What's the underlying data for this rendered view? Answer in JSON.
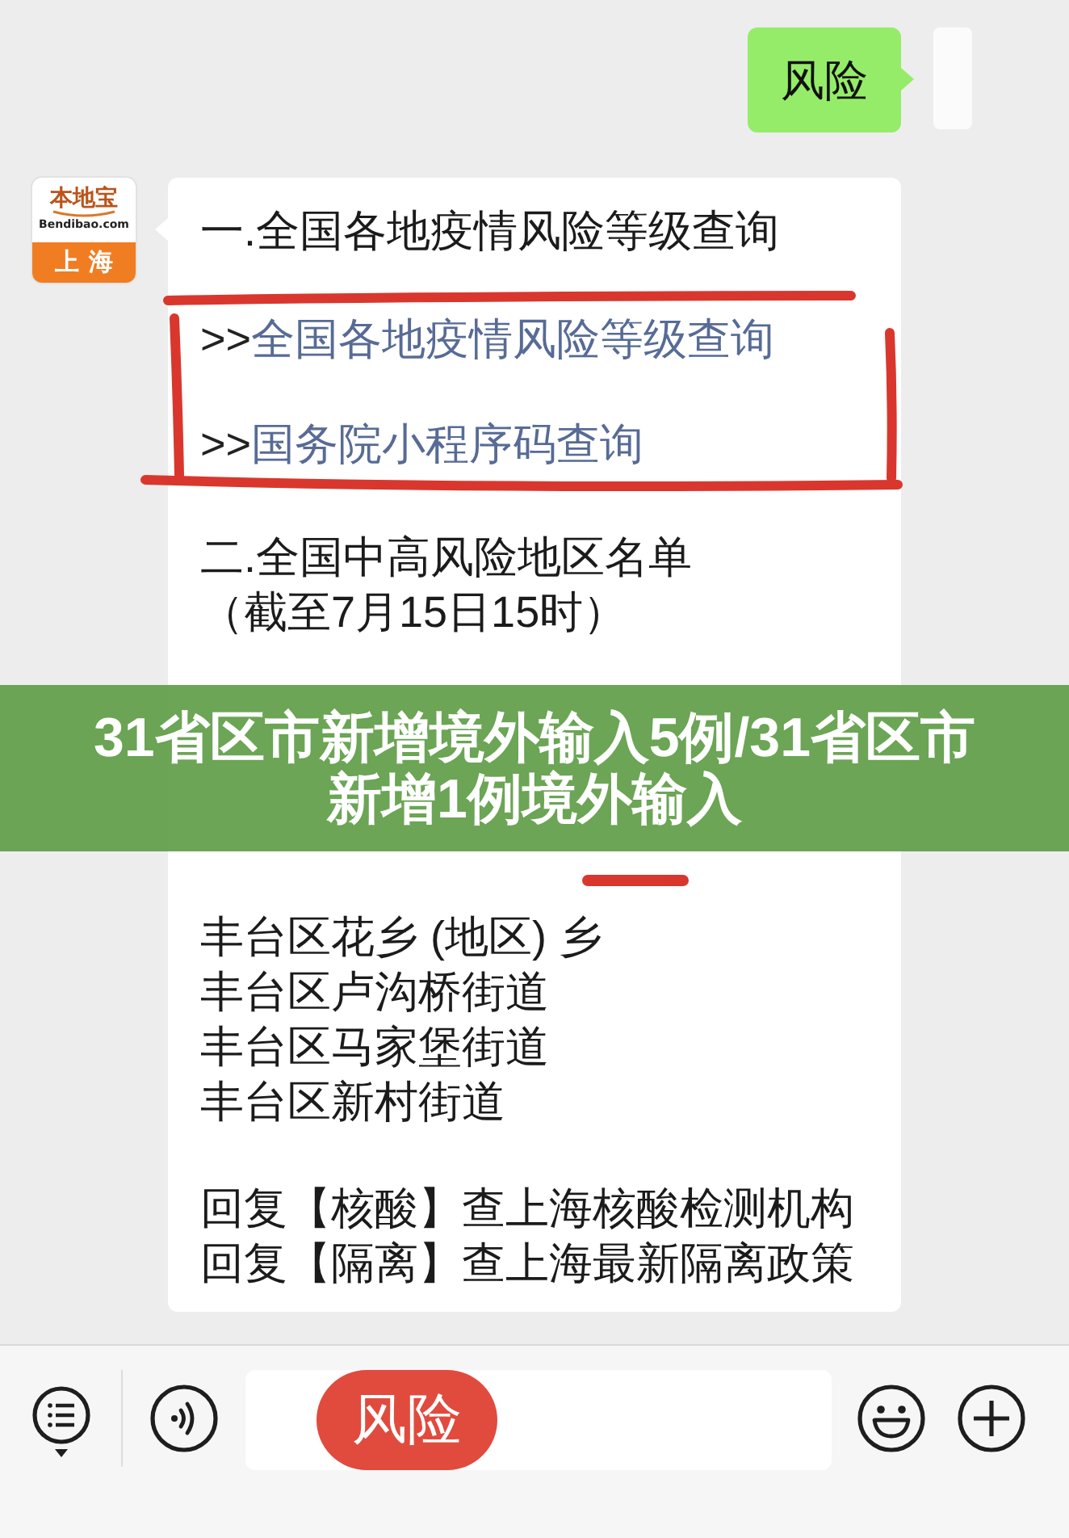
{
  "chat": {
    "outgoing": {
      "text": "风险"
    },
    "incoming": {
      "sender_logo": {
        "title": "本地宝",
        "site": "Bendibao.com",
        "city": "上海"
      },
      "sections": [
        {
          "kind": "heading",
          "text": "一.全国各地疫情风险等级查询"
        },
        {
          "kind": "links",
          "items": [
            {
              "prefix": ">>",
              "text": "全国各地疫情风险等级查询"
            },
            {
              "prefix": ">>",
              "text": "国务院小程序码查询"
            }
          ]
        },
        {
          "kind": "heading",
          "text": "二.全国中高风险地区名单",
          "note": "（截至7月15日15时）"
        },
        {
          "kind": "list",
          "items": [
            "丰台区花乡 (地区) 乡",
            "丰台区卢沟桥街道",
            "丰台区马家堡街道",
            "丰台区新村街道"
          ]
        },
        {
          "kind": "list",
          "items": [
            "回复【核酸】查上海核酸检测机构",
            "回复【隔离】查上海最新隔离政策"
          ]
        }
      ]
    }
  },
  "overlay_title": "31省区市新增境外输入5例/31省区市新增1例境外输入",
  "input_bar": {
    "tag": "风险"
  }
}
